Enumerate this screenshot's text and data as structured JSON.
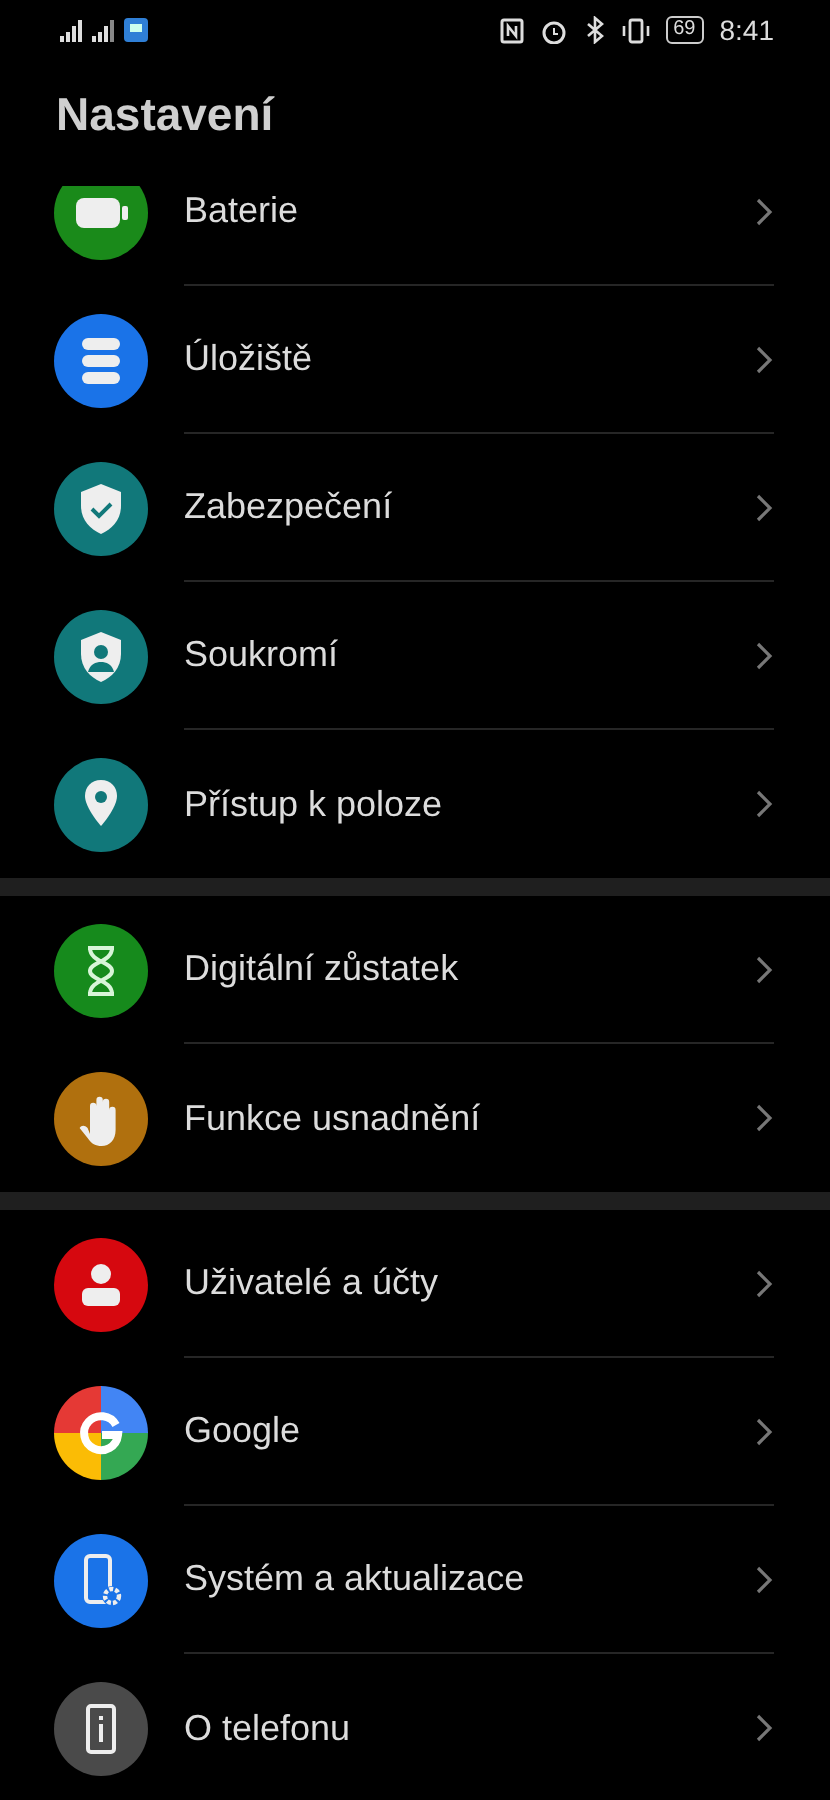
{
  "status_bar": {
    "battery": "69",
    "time": "8:41"
  },
  "title": "Nastavení",
  "groups": [
    {
      "items": [
        {
          "label": "Baterie",
          "kind": "battery",
          "color": "#1a8a1a"
        },
        {
          "label": "Úložiště",
          "kind": "storage",
          "color": "#1a73e8"
        },
        {
          "label": "Zabezpečení",
          "kind": "shield",
          "color": "#11787a"
        },
        {
          "label": "Soukromí",
          "kind": "privacy",
          "color": "#11787a"
        },
        {
          "label": "Přístup k poloze",
          "kind": "location",
          "color": "#11787a"
        }
      ]
    },
    {
      "items": [
        {
          "label": "Digitální zůstatek",
          "kind": "hourglass",
          "color": "#168a1c"
        },
        {
          "label": "Funkce usnadnění",
          "kind": "hand",
          "color": "#b0700e"
        }
      ]
    },
    {
      "items": [
        {
          "label": "Uživatelé a účty",
          "kind": "user",
          "color": "#d6080f"
        },
        {
          "label": "Google",
          "kind": "google"
        },
        {
          "label": "Systém a aktualizace",
          "kind": "phone-gear",
          "color": "#1a73e8"
        },
        {
          "label": "O telefonu",
          "kind": "info",
          "color": "#4a4a4a"
        }
      ]
    }
  ]
}
